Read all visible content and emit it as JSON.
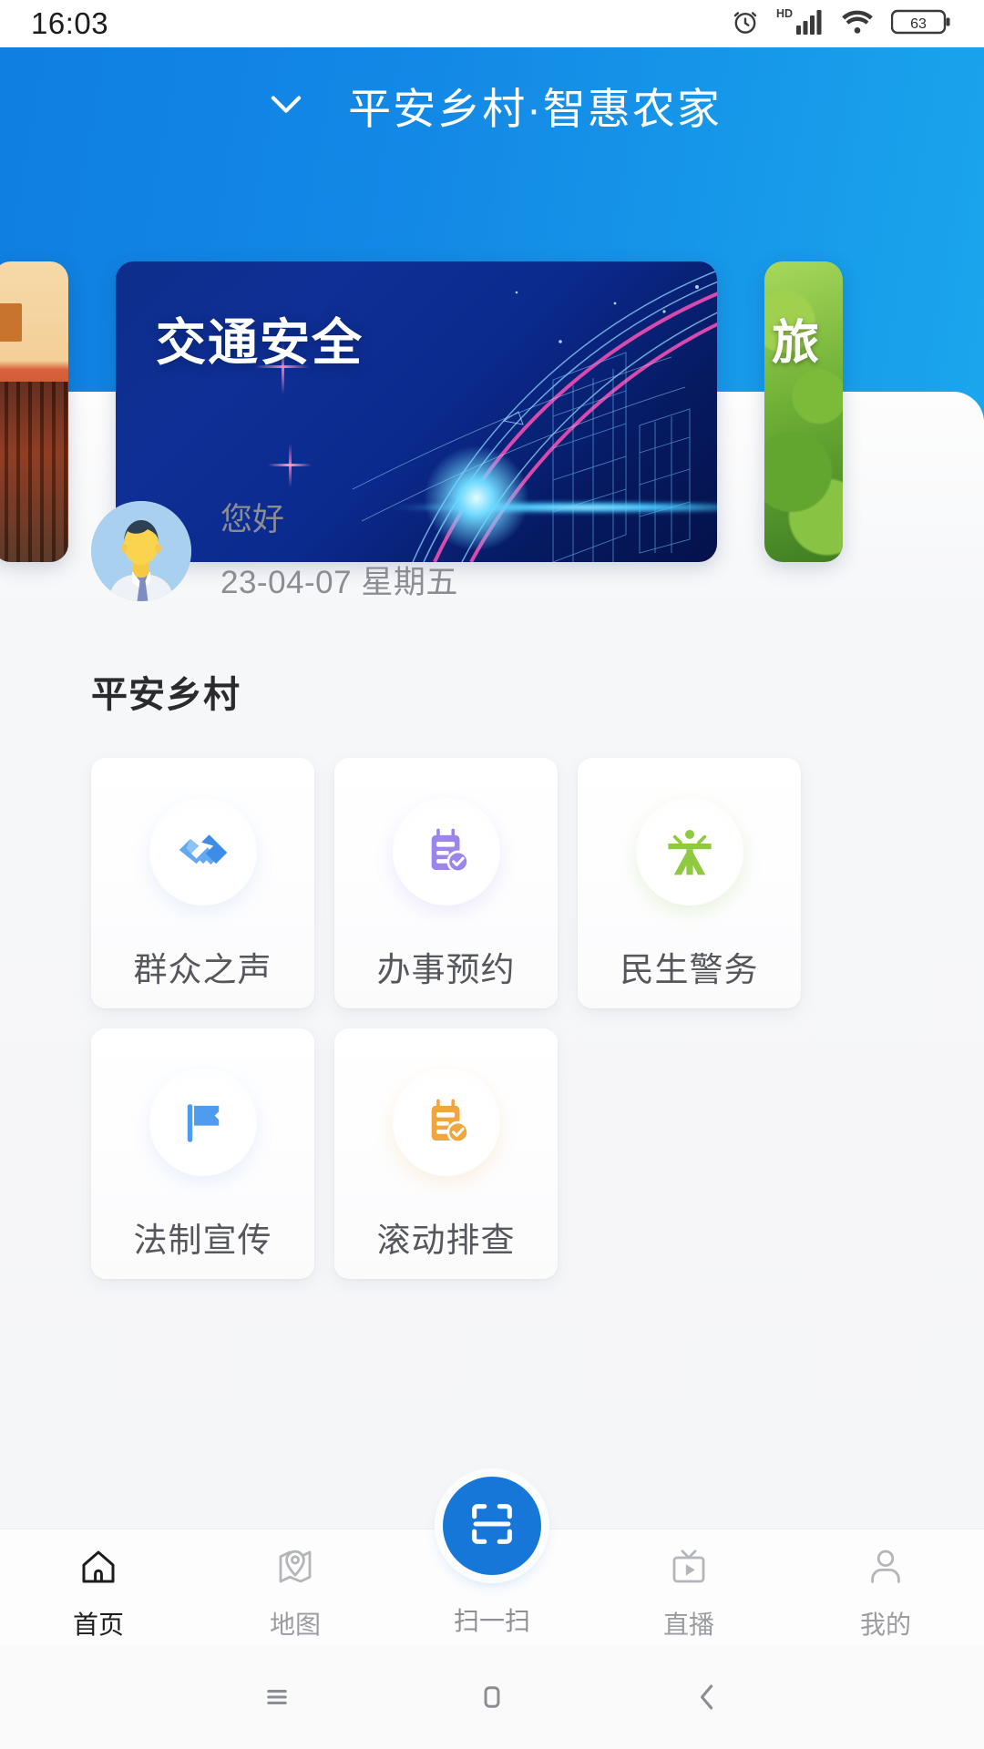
{
  "statusbar": {
    "time": "16:03",
    "battery_level": "63",
    "icons": [
      "alarm-icon",
      "hd-icon",
      "signal-icon",
      "wifi-icon",
      "battery-icon"
    ]
  },
  "header": {
    "title": "平安乡村·智惠农家",
    "dropdown_icon": "chevron-down-icon",
    "bg_color": "#1389e6"
  },
  "carousel": {
    "slides": [
      {
        "title": "",
        "theme": "heritage-orange"
      },
      {
        "title": "交通安全",
        "theme": "traffic-blue"
      },
      {
        "title": "旅",
        "theme": "nature-green"
      }
    ],
    "active_index": 1
  },
  "greeting": {
    "avatar": "user-avatar",
    "hello": "您好",
    "date": "23-04-07 星期五"
  },
  "section": {
    "title": "平安乡村"
  },
  "grid": {
    "items": [
      {
        "label": "群众之声",
        "icon": "handshake-icon",
        "color": "#4e9bf0"
      },
      {
        "label": "办事预约",
        "icon": "calendar-check-icon",
        "color": "#9b85ea"
      },
      {
        "label": "民生警务",
        "icon": "person-service-icon",
        "color": "#8fc93f"
      },
      {
        "label": "法制宣传",
        "icon": "flag-icon",
        "color": "#4e9bf0"
      },
      {
        "label": "滚动排查",
        "icon": "clipboard-check-icon",
        "color": "#f0a63c"
      }
    ]
  },
  "tabbar": {
    "items": [
      {
        "label": "首页",
        "icon": "home-icon",
        "active": true
      },
      {
        "label": "地图",
        "icon": "map-pin-icon",
        "active": false
      },
      {
        "label": "扫一扫",
        "icon": "scan-icon",
        "active": false
      },
      {
        "label": "直播",
        "icon": "live-tv-icon",
        "active": false
      },
      {
        "label": "我的",
        "icon": "profile-icon",
        "active": false
      }
    ],
    "fab_color": "#1677d9"
  },
  "sysnav": {
    "buttons": [
      "recents-icon",
      "home-square-icon",
      "back-icon"
    ]
  }
}
